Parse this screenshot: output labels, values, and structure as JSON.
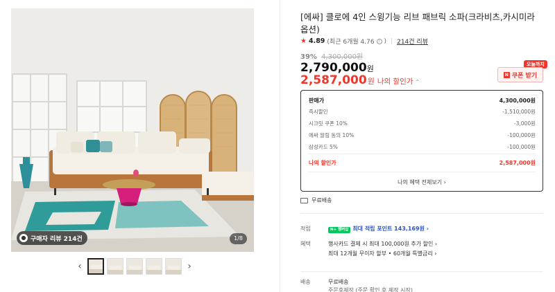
{
  "gallery": {
    "review_pill": "구매자 리뷰 214건",
    "page_counter": "1/8",
    "prev_arrow": "‹",
    "next_arrow": "›",
    "thumb_count": 5
  },
  "product": {
    "title": "[에싸] 클로에 4인 스윙기능 리브 패브릭 소파(크라비츠,카시미라 옵션)",
    "rating": "4.89",
    "rating_recent": "(최근 6개월 4.76",
    "review_count": "214건 리뷰",
    "discount_pct": "39%",
    "original_price": "4,300,000원",
    "price": "2,790,000",
    "price_unit": "원",
    "my_price": "2,587,000",
    "my_price_unit": "원",
    "my_price_label": "나의 할인가",
    "coupon_badge": "오늘까지",
    "coupon_button": "쿠폰 받기"
  },
  "breakdown": {
    "rows": [
      {
        "label": "판매가",
        "value": "4,300,000원"
      },
      {
        "label": "즉시할인",
        "value": "-1,510,000원"
      },
      {
        "label": "시크릿 쿠폰 10%",
        "value": "-3,000원"
      },
      {
        "label": "에싸 알림 동의 10%",
        "value": "-100,000원"
      },
      {
        "label": "삼성카드 5%",
        "value": "-100,000원"
      }
    ],
    "final_label": "나의 할인가",
    "final_value": "2,587,000원",
    "all_benefits": "나의 혜택 전체보기 ›"
  },
  "shipping_summary": "무료배송",
  "info": {
    "points_label": "적립",
    "npay_badge": "N+ 멤버십",
    "points_value": "최대 적립 포인트 143,169원 ›",
    "benefits_label": "혜택",
    "benefits_line1": "행사카드 결제 시 최대 100,000원 추가 할인 ›",
    "benefits_line2": "최대 12개월 무이자 할부 • 60개월 특별금리 ›",
    "delivery_label": "배송",
    "delivery_line1": "무료배송",
    "delivery_line2": "주문후제작 (주문 확인 후 제작 시작)"
  },
  "colors": {
    "accent_red": "#f0362b",
    "npay_green": "#03c75a",
    "link_blue": "#2d55c8"
  }
}
